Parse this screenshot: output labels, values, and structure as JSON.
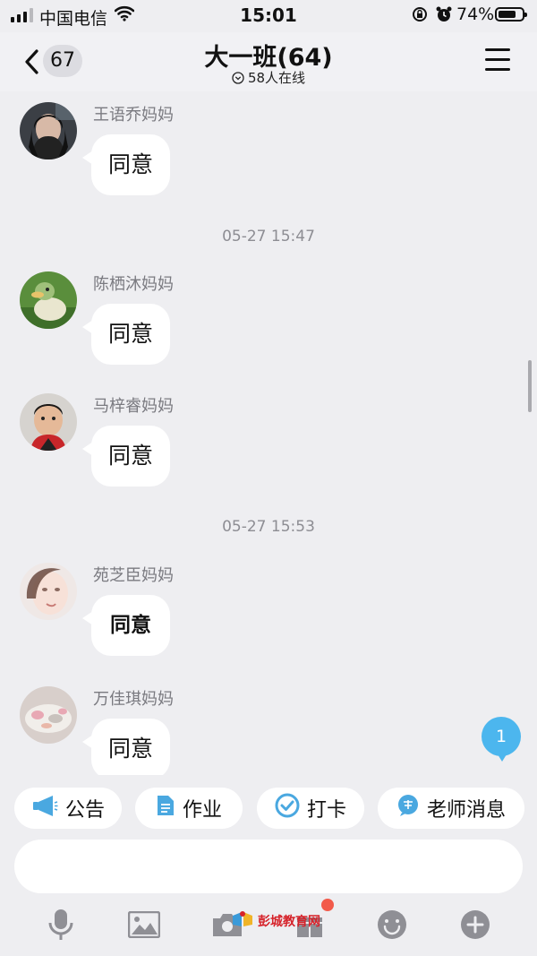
{
  "status_bar": {
    "carrier": "中国电信",
    "time": "15:01",
    "battery_percent": "74%",
    "battery_level": 0.74
  },
  "header": {
    "back_count": "67",
    "title": "大一班(64)",
    "online_text": "58人在线"
  },
  "messages": [
    {
      "sender": "王语乔妈妈",
      "text": "同意"
    },
    {
      "sender": "陈栖沐妈妈",
      "text": "同意"
    },
    {
      "sender": "马梓睿妈妈",
      "text": "同意"
    },
    {
      "sender": "苑芝臣妈妈",
      "text": "同意"
    },
    {
      "sender": "万佳琪妈妈",
      "text": "同意"
    }
  ],
  "timestamps": [
    "05-27 15:47",
    "05-27 15:53"
  ],
  "new_message_count": "1",
  "quick_actions": [
    {
      "label": "公告",
      "icon": "megaphone-icon"
    },
    {
      "label": "作业",
      "icon": "document-icon"
    },
    {
      "label": "打卡",
      "icon": "check-circle-icon"
    },
    {
      "label": "老师消息",
      "icon": "teacher-icon"
    }
  ],
  "input": {
    "value": ""
  },
  "toolbar_icons": [
    "microphone-icon",
    "image-icon",
    "camera-icon",
    "gift-icon",
    "emoji-icon",
    "plus-icon"
  ],
  "watermark": "彭城教育网",
  "colors": {
    "accent_blue": "#4cb6ee",
    "background": "#eeeef1",
    "bubble": "#ffffff",
    "notification_dot": "#f25a4a"
  }
}
